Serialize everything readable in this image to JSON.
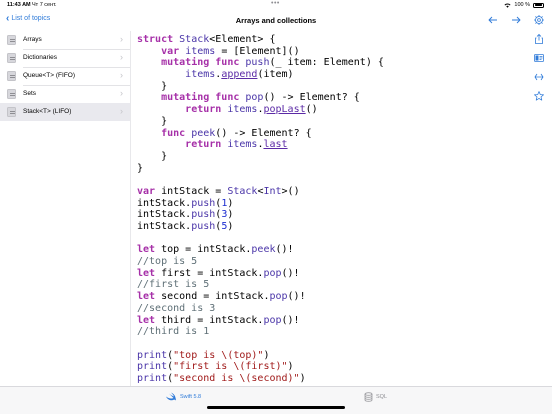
{
  "status_bar": {
    "time": "11:43 AM",
    "date": "Чт 7 сент.",
    "battery": "100 %"
  },
  "nav": {
    "back_label": "List of topics",
    "title": "Arrays and collections",
    "icons": [
      "undo-arrow-icon",
      "redo-arrow-icon",
      "gear-icon"
    ]
  },
  "sidebar": {
    "items": [
      {
        "label": "Arrays",
        "selected": false
      },
      {
        "label": "Dictionaries",
        "selected": false
      },
      {
        "label": "Queue<T> (FIFO)",
        "selected": false
      },
      {
        "label": "Sets",
        "selected": false
      },
      {
        "label": "Stack<T> (LIFO)",
        "selected": true
      }
    ]
  },
  "code_lines": [
    [
      {
        "t": "struct ",
        "c": "kw"
      },
      {
        "t": "Stack",
        "c": "ty"
      },
      {
        "t": "<Element> {"
      }
    ],
    [
      {
        "t": "    "
      },
      {
        "t": "var ",
        "c": "kw"
      },
      {
        "t": "items",
        "c": "fn"
      },
      {
        "t": " = [Element]()"
      }
    ],
    [
      {
        "t": "    "
      },
      {
        "t": "mutating ",
        "c": "kw"
      },
      {
        "t": "func ",
        "c": "kw"
      },
      {
        "t": "push",
        "c": "fn"
      },
      {
        "t": "(_ item: Element) {"
      }
    ],
    [
      {
        "t": "        "
      },
      {
        "t": "items",
        "c": "fn"
      },
      {
        "t": "."
      },
      {
        "t": "append",
        "c": "mth"
      },
      {
        "t": "(item)"
      }
    ],
    [
      {
        "t": "    }"
      }
    ],
    [
      {
        "t": "    "
      },
      {
        "t": "mutating ",
        "c": "kw"
      },
      {
        "t": "func ",
        "c": "kw"
      },
      {
        "t": "pop",
        "c": "fn"
      },
      {
        "t": "() -> Element? {"
      }
    ],
    [
      {
        "t": "        "
      },
      {
        "t": "return ",
        "c": "kw"
      },
      {
        "t": "items",
        "c": "fn"
      },
      {
        "t": "."
      },
      {
        "t": "popLast",
        "c": "mth"
      },
      {
        "t": "()"
      }
    ],
    [
      {
        "t": "    }"
      }
    ],
    [
      {
        "t": "    "
      },
      {
        "t": "func ",
        "c": "kw"
      },
      {
        "t": "peek",
        "c": "fn"
      },
      {
        "t": "() -> Element? {"
      }
    ],
    [
      {
        "t": "        "
      },
      {
        "t": "return ",
        "c": "kw"
      },
      {
        "t": "items",
        "c": "fn"
      },
      {
        "t": "."
      },
      {
        "t": "last",
        "c": "mth"
      }
    ],
    [
      {
        "t": "    }"
      }
    ],
    [
      {
        "t": "}"
      }
    ],
    [
      {
        "t": ""
      }
    ],
    [
      {
        "t": "var ",
        "c": "kw"
      },
      {
        "t": "intStack = "
      },
      {
        "t": "Stack",
        "c": "ty"
      },
      {
        "t": "<"
      },
      {
        "t": "Int",
        "c": "ty"
      },
      {
        "t": ">()"
      }
    ],
    [
      {
        "t": "intStack."
      },
      {
        "t": "push",
        "c": "fn"
      },
      {
        "t": "("
      },
      {
        "t": "1",
        "c": "num"
      },
      {
        "t": ")"
      }
    ],
    [
      {
        "t": "intStack."
      },
      {
        "t": "push",
        "c": "fn"
      },
      {
        "t": "("
      },
      {
        "t": "3",
        "c": "num"
      },
      {
        "t": ")"
      }
    ],
    [
      {
        "t": "intStack."
      },
      {
        "t": "push",
        "c": "fn"
      },
      {
        "t": "("
      },
      {
        "t": "5",
        "c": "num"
      },
      {
        "t": ")"
      }
    ],
    [
      {
        "t": ""
      }
    ],
    [
      {
        "t": "let ",
        "c": "kw"
      },
      {
        "t": "top = intStack."
      },
      {
        "t": "peek",
        "c": "fn"
      },
      {
        "t": "()!"
      }
    ],
    [
      {
        "t": "//top is 5",
        "c": "cm"
      }
    ],
    [
      {
        "t": "let ",
        "c": "kw"
      },
      {
        "t": "first = intStack."
      },
      {
        "t": "pop",
        "c": "fn"
      },
      {
        "t": "()!"
      }
    ],
    [
      {
        "t": "//first is 5",
        "c": "cm"
      }
    ],
    [
      {
        "t": "let ",
        "c": "kw"
      },
      {
        "t": "second = intStack."
      },
      {
        "t": "pop",
        "c": "fn"
      },
      {
        "t": "()!"
      }
    ],
    [
      {
        "t": "//second is 3",
        "c": "cm"
      }
    ],
    [
      {
        "t": "let ",
        "c": "kw"
      },
      {
        "t": "third = intStack."
      },
      {
        "t": "pop",
        "c": "fn"
      },
      {
        "t": "()!"
      }
    ],
    [
      {
        "t": "//third is 1",
        "c": "cm"
      }
    ],
    [
      {
        "t": ""
      }
    ],
    [
      {
        "t": "print",
        "c": "fn"
      },
      {
        "t": "("
      },
      {
        "t": "\"top is \\(top)\"",
        "c": "str"
      },
      {
        "t": ")"
      }
    ],
    [
      {
        "t": "print",
        "c": "fn"
      },
      {
        "t": "("
      },
      {
        "t": "\"first is \\(first)\"",
        "c": "str"
      },
      {
        "t": ")"
      }
    ],
    [
      {
        "t": "print",
        "c": "fn"
      },
      {
        "t": "("
      },
      {
        "t": "\"second is \\(second)\"",
        "c": "str"
      },
      {
        "t": ")"
      }
    ]
  ],
  "rail_icons": [
    "share-icon",
    "layout-icon",
    "swap-icon",
    "star-icon"
  ],
  "bottom_bar": {
    "swift_label": "Swift 5.8",
    "sql_label": "SQL"
  },
  "colors": {
    "accent": "#2f7bd9",
    "keyword": "#a630a8",
    "comment": "#5e6f76",
    "string": "#a01a1a",
    "number": "#1c2cd0"
  }
}
